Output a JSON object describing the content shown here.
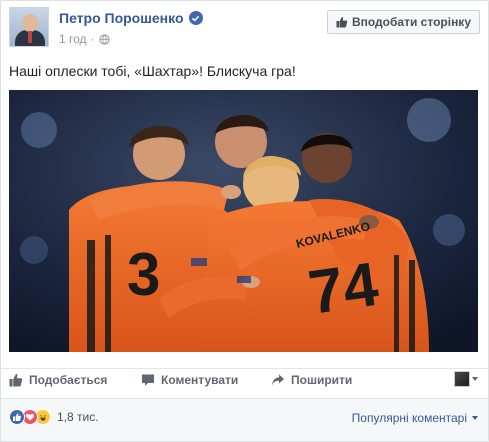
{
  "post": {
    "author_name": "Петро Порошенко",
    "timestamp": "1 год",
    "separator": "·",
    "text": "Наші оплески тобі, «Шахтар»! Блискуча гра!",
    "like_page_label": "Вподобати сторінку"
  },
  "photo": {
    "jersey_number_left": "3",
    "jersey_number_right": "74",
    "jersey_name_right": "KOVALENKO"
  },
  "actions": {
    "like_label": "Подобається",
    "comment_label": "Коментувати",
    "share_label": "Поширити"
  },
  "footer": {
    "reaction_count": "1,8 тис.",
    "sort_label": "Популярні коментарі"
  },
  "colors": {
    "link_blue": "#365899",
    "brand_blue": "#4267b2",
    "kit_orange": "#f0692a"
  }
}
